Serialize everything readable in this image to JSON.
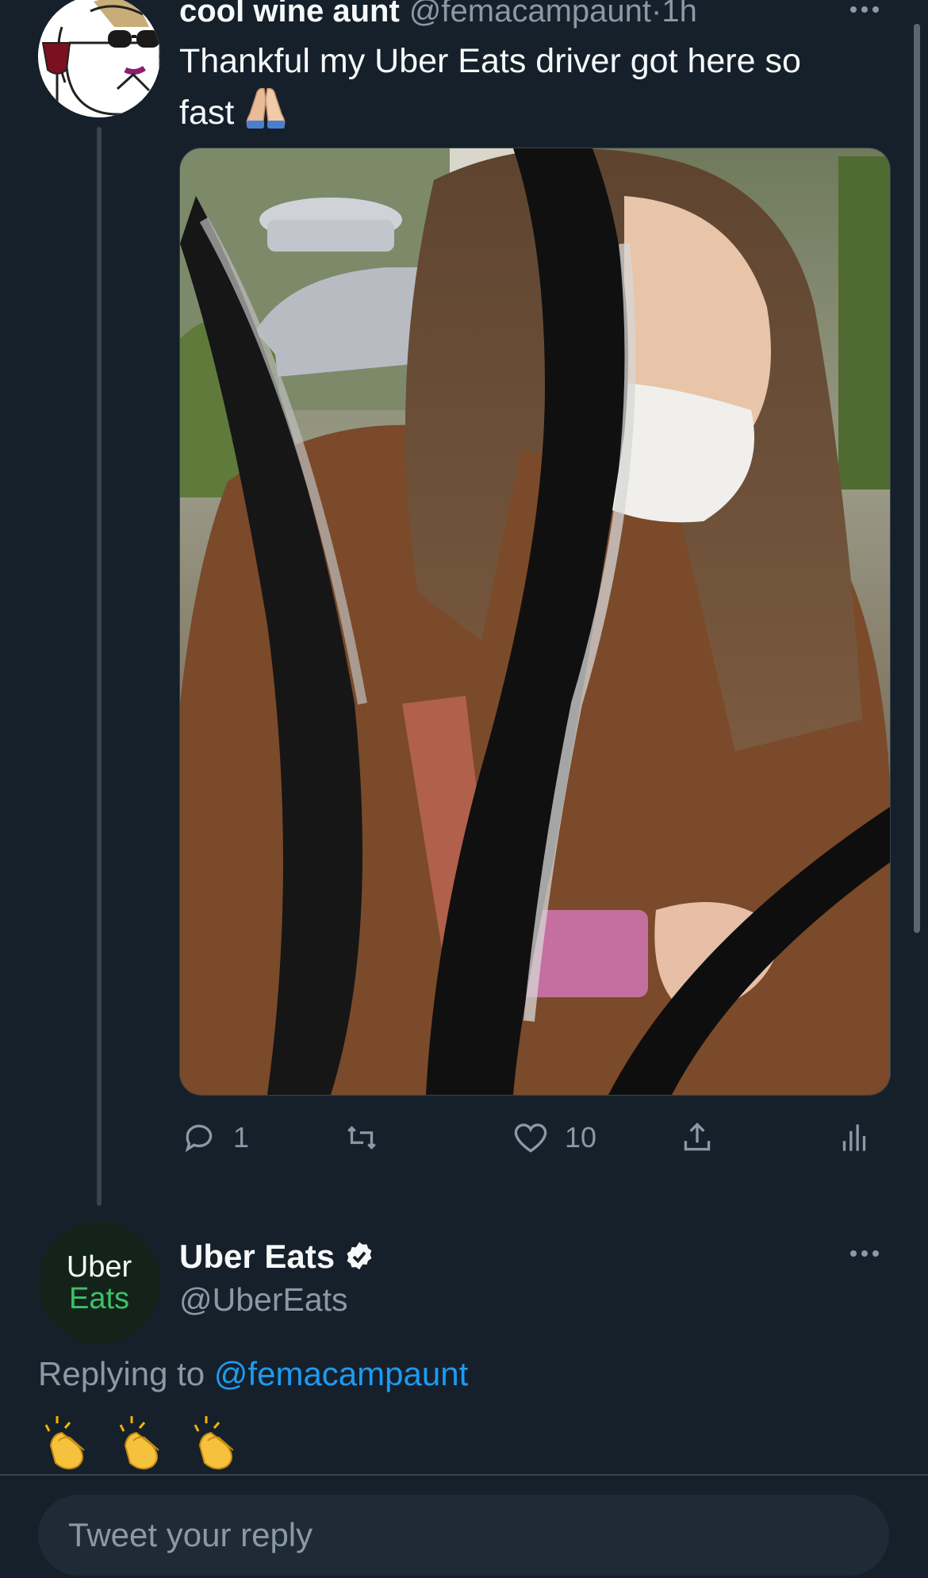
{
  "tweet": {
    "author_name": "cool wine aunt",
    "author_handle": "@femacampaunt",
    "time_separator": "·",
    "time": "1h",
    "text": "Thankful my Uber Eats driver got here so fast",
    "text_emoji": "folded-hands",
    "stats": {
      "replies": "1",
      "retweets": "",
      "likes": "10"
    }
  },
  "reply": {
    "author_name": "Uber Eats",
    "author_handle": "@UberEats",
    "verified": true,
    "avatar_line1": "Uber",
    "avatar_line2": "Eats",
    "replying_prefix": "Replying to",
    "replying_to": "@femacampaunt",
    "emojis": [
      "clapping-hands",
      "clapping-hands",
      "clapping-hands"
    ]
  },
  "composer": {
    "placeholder": "Tweet your reply"
  },
  "colors": {
    "background": "#15202b",
    "text": "#f7f9f9",
    "secondary": "#8b98a5",
    "accent": "#1d9bf0",
    "brand_green": "#3ec06b"
  }
}
